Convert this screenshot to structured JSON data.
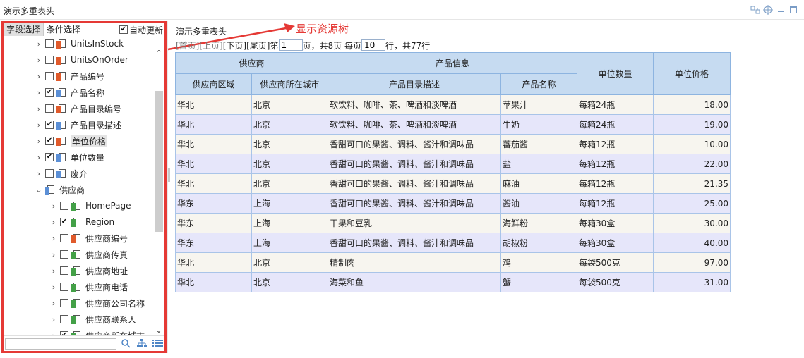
{
  "window": {
    "title": "演示多重表头",
    "tools": [
      "layout-icon",
      "target-icon",
      "minimize-icon",
      "maximize-icon"
    ]
  },
  "left_panel": {
    "tabs": [
      "字段选择",
      "条件选择"
    ],
    "auto_update": {
      "label": "自动更新",
      "checked": true
    },
    "tree": [
      {
        "label": "UnitsInStock",
        "checked": false,
        "icon": "red",
        "arrow": "›",
        "indent": 0
      },
      {
        "label": "UnitsOnOrder",
        "checked": false,
        "icon": "red",
        "arrow": "›",
        "indent": 0
      },
      {
        "label": "产品编号",
        "checked": false,
        "icon": "red",
        "arrow": "›",
        "indent": 0
      },
      {
        "label": "产品名称",
        "checked": true,
        "icon": "blue",
        "arrow": "›",
        "indent": 0
      },
      {
        "label": "产品目录编号",
        "checked": false,
        "icon": "red",
        "arrow": "›",
        "indent": 0
      },
      {
        "label": "产品目录描述",
        "checked": true,
        "icon": "blue",
        "arrow": "›",
        "indent": 0
      },
      {
        "label": "单位价格",
        "checked": true,
        "icon": "red",
        "arrow": "›",
        "indent": 0,
        "highlight": true
      },
      {
        "label": "单位数量",
        "checked": true,
        "icon": "blue",
        "arrow": "›",
        "indent": 0
      },
      {
        "label": "废弃",
        "checked": false,
        "icon": "blue",
        "arrow": "›",
        "indent": 0
      },
      {
        "label": "供应商",
        "checked": null,
        "icon": "blue",
        "arrow": "⌄",
        "indent": 0
      },
      {
        "label": "HomePage",
        "checked": false,
        "icon": "green",
        "arrow": "›",
        "indent": 1
      },
      {
        "label": "Region",
        "checked": true,
        "icon": "green",
        "arrow": "›",
        "indent": 1
      },
      {
        "label": "供应商编号",
        "checked": false,
        "icon": "red",
        "arrow": "›",
        "indent": 1
      },
      {
        "label": "供应商传真",
        "checked": false,
        "icon": "green",
        "arrow": "›",
        "indent": 1
      },
      {
        "label": "供应商地址",
        "checked": false,
        "icon": "green",
        "arrow": "›",
        "indent": 1
      },
      {
        "label": "供应商电话",
        "checked": false,
        "icon": "green",
        "arrow": "›",
        "indent": 1
      },
      {
        "label": "供应商公司名称",
        "checked": false,
        "icon": "green",
        "arrow": "›",
        "indent": 1
      },
      {
        "label": "供应商联系人",
        "checked": false,
        "icon": "green",
        "arrow": "›",
        "indent": 1
      },
      {
        "label": "供应商所在城市",
        "checked": true,
        "icon": "green",
        "arrow": "›",
        "indent": 1
      }
    ],
    "search_placeholder": "",
    "bottom_icons": [
      "search-icon",
      "hierarchy-icon",
      "list-icon"
    ]
  },
  "annotation": {
    "text": "显示资源树",
    "color": "#e53935"
  },
  "report": {
    "title": "演示多重表头",
    "pager": {
      "first": "[首页]",
      "prev": "[上页]",
      "next": "[下页]",
      "last": "[尾页]",
      "page_prefix": "第",
      "page_value": "1",
      "page_suffix": "页，共8页 每页",
      "page_size_value": "10",
      "rows_suffix": "行，共77行"
    },
    "header_groups": {
      "supplier": "供应商",
      "product_info": "产品信息",
      "unit_qty": "单位数量",
      "unit_price": "单位价格"
    },
    "columns": [
      "供应商区域",
      "供应商所在城市",
      "产品目录描述",
      "产品名称"
    ],
    "rows": [
      [
        "华北",
        "北京",
        "软饮料、咖啡、茶、啤酒和淡啤酒",
        "苹果汁",
        "每箱24瓶",
        "18.00"
      ],
      [
        "华北",
        "北京",
        "软饮料、咖啡、茶、啤酒和淡啤酒",
        "牛奶",
        "每箱24瓶",
        "19.00"
      ],
      [
        "华北",
        "北京",
        "香甜可口的果酱、调料、酱汁和调味品",
        "蕃茄酱",
        "每箱12瓶",
        "10.00"
      ],
      [
        "华北",
        "北京",
        "香甜可口的果酱、调料、酱汁和调味品",
        "盐",
        "每箱12瓶",
        "22.00"
      ],
      [
        "华北",
        "北京",
        "香甜可口的果酱、调料、酱汁和调味品",
        "麻油",
        "每箱12瓶",
        "21.35"
      ],
      [
        "华东",
        "上海",
        "香甜可口的果酱、调料、酱汁和调味品",
        "酱油",
        "每箱12瓶",
        "25.00"
      ],
      [
        "华东",
        "上海",
        "干果和豆乳",
        "海鲜粉",
        "每箱30盒",
        "30.00"
      ],
      [
        "华东",
        "上海",
        "香甜可口的果酱、调料、酱汁和调味品",
        "胡椒粉",
        "每箱30盒",
        "40.00"
      ],
      [
        "华北",
        "北京",
        "精制肉",
        "鸡",
        "每袋500克",
        "97.00"
      ],
      [
        "华北",
        "北京",
        "海菜和鱼",
        "蟹",
        "每袋500克",
        "31.00"
      ]
    ]
  }
}
